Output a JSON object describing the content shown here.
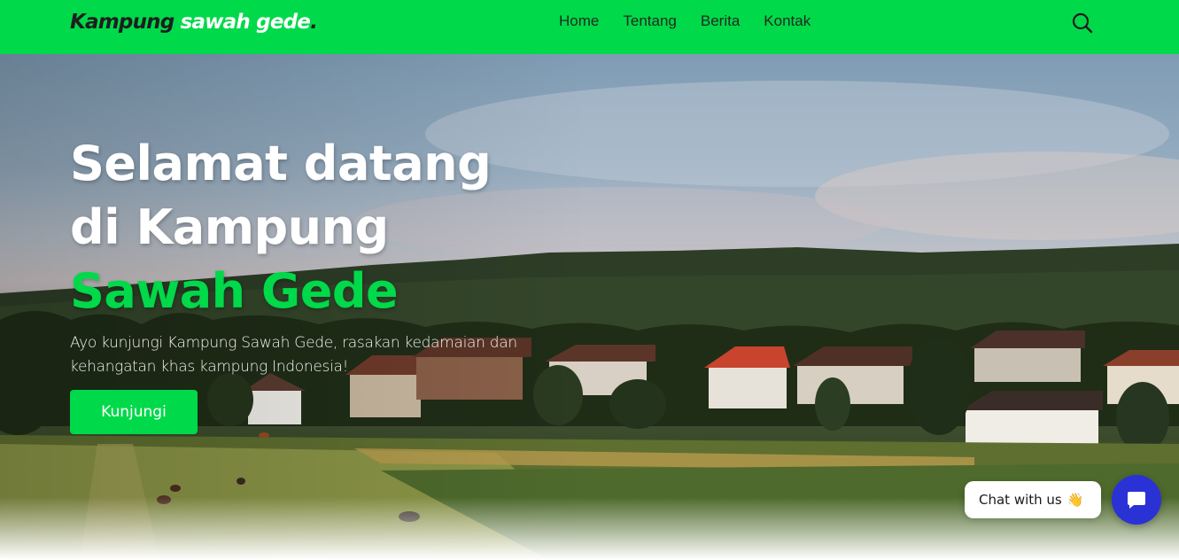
{
  "header": {
    "logo": {
      "part1": "Kampung",
      "part2": "sawah gede",
      "dot": "."
    },
    "nav": [
      {
        "label": "Home"
      },
      {
        "label": "Tentang"
      },
      {
        "label": "Berita"
      },
      {
        "label": "Kontak"
      }
    ],
    "search_icon": "search-icon"
  },
  "hero": {
    "title_line1": "Selamat datang",
    "title_line2": "di Kampung",
    "title_highlight": "Sawah Gede",
    "subtitle": "Ayo kunjungi Kampung Sawah Gede, rasakan kedamaian dan kehangatan khas kampung Indonesia!",
    "cta_label": "Kunjungi"
  },
  "chat": {
    "bubble_label": "Chat with us",
    "bubble_emoji": "👋",
    "button_icon": "chat-icon"
  },
  "colors": {
    "brand": "#00d94a",
    "text_dark": "#1e1e1e",
    "chat_button": "#2a32d6"
  }
}
